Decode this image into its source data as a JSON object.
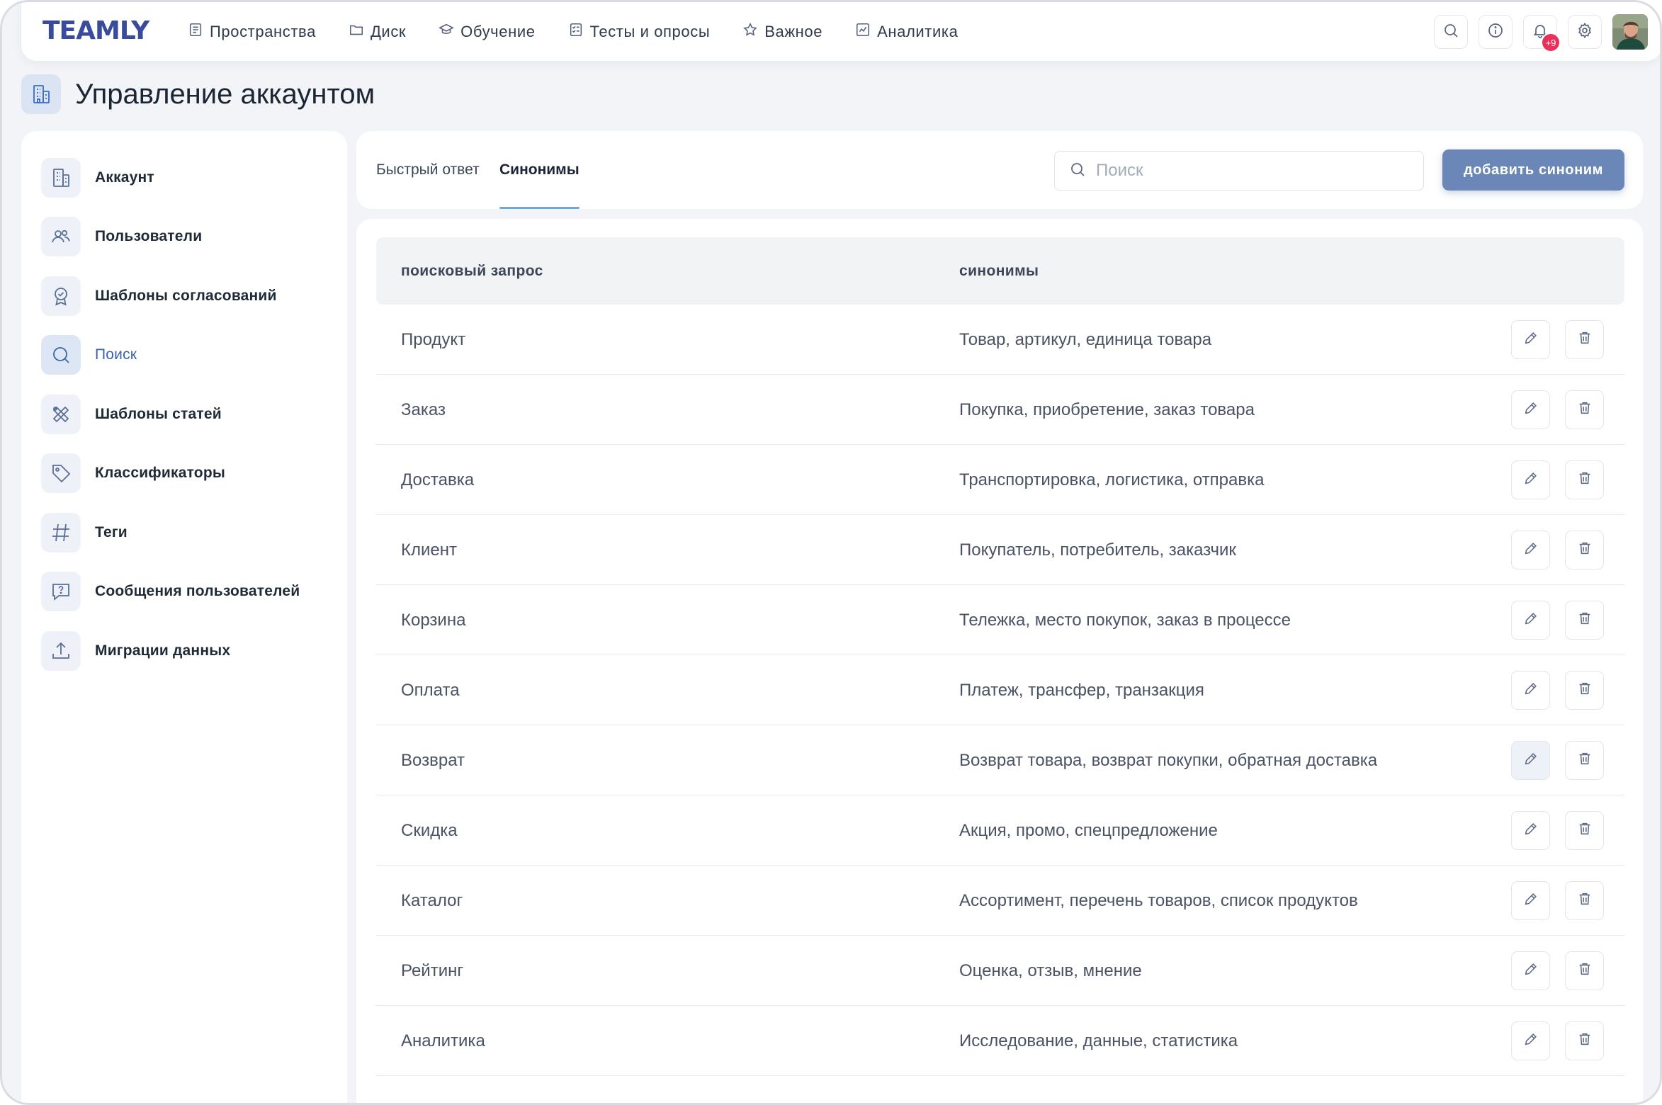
{
  "app": {
    "logo": "TEAMLY"
  },
  "nav": {
    "items": [
      {
        "label": "Пространства",
        "icon": "spaces-icon"
      },
      {
        "label": "Диск",
        "icon": "folder-icon"
      },
      {
        "label": "Обучение",
        "icon": "graduation-cap-icon"
      },
      {
        "label": "Тесты и опросы",
        "icon": "checklist-icon"
      },
      {
        "label": "Важное",
        "icon": "star-icon"
      },
      {
        "label": "Аналитика",
        "icon": "chart-icon"
      }
    ],
    "notifications_badge": "+9"
  },
  "page": {
    "title": "Управление аккаунтом"
  },
  "sidebar": {
    "items": [
      {
        "label": "Аккаунт",
        "icon": "building-icon"
      },
      {
        "label": "Пользователи",
        "icon": "users-icon"
      },
      {
        "label": "Шаблоны согласований",
        "icon": "approval-badge-icon"
      },
      {
        "label": "Поиск",
        "icon": "search-icon"
      },
      {
        "label": "Шаблоны статей",
        "icon": "tools-icon"
      },
      {
        "label": "Классификаторы",
        "icon": "tag-icon"
      },
      {
        "label": "Теги",
        "icon": "hashtag-icon"
      },
      {
        "label": "Сообщения пользователей",
        "icon": "message-question-icon"
      },
      {
        "label": "Миграции данных",
        "icon": "upload-icon"
      }
    ],
    "active": "Поиск"
  },
  "tabs": [
    {
      "label": "Быстрый ответ"
    },
    {
      "label": "Синонимы"
    }
  ],
  "search": {
    "placeholder": "Поиск",
    "value": ""
  },
  "toolbar": {
    "add_label": "добавить синоним"
  },
  "table": {
    "columns": [
      "поисковый запрос",
      "синонимы"
    ],
    "rows": [
      {
        "query": "Продукт",
        "synonyms": "Товар, артикул, единица товара"
      },
      {
        "query": "Заказ",
        "synonyms": "Покупка, приобретение, заказ товара"
      },
      {
        "query": "Доставка",
        "synonyms": "Транспортировка, логистика, отправка"
      },
      {
        "query": "Клиент",
        "synonyms": "Покупатель, потребитель, заказчик"
      },
      {
        "query": "Корзина",
        "synonyms": "Тележка, место покупок, заказ в процессе"
      },
      {
        "query": "Оплата",
        "synonyms": "Платеж, трансфер, транзакция"
      },
      {
        "query": "Возврат",
        "synonyms": "Возврат товара, возврат покупки, обратная доставка"
      },
      {
        "query": "Скидка",
        "synonyms": "Акция, промо, спецпредложение"
      },
      {
        "query": "Каталог",
        "synonyms": "Ассортимент, перечень товаров, список продуктов"
      },
      {
        "query": "Рейтинг",
        "synonyms": "Оценка, отзыв, мнение"
      },
      {
        "query": "Аналитика",
        "synonyms": "Исследование, данные, статистика"
      }
    ]
  },
  "colors": {
    "accent": "#6b87b8",
    "active_text": "#3b63a8",
    "tab_underline": "#6aa9d8",
    "badge": "#e8305a",
    "logo": "#3a4a9c"
  }
}
